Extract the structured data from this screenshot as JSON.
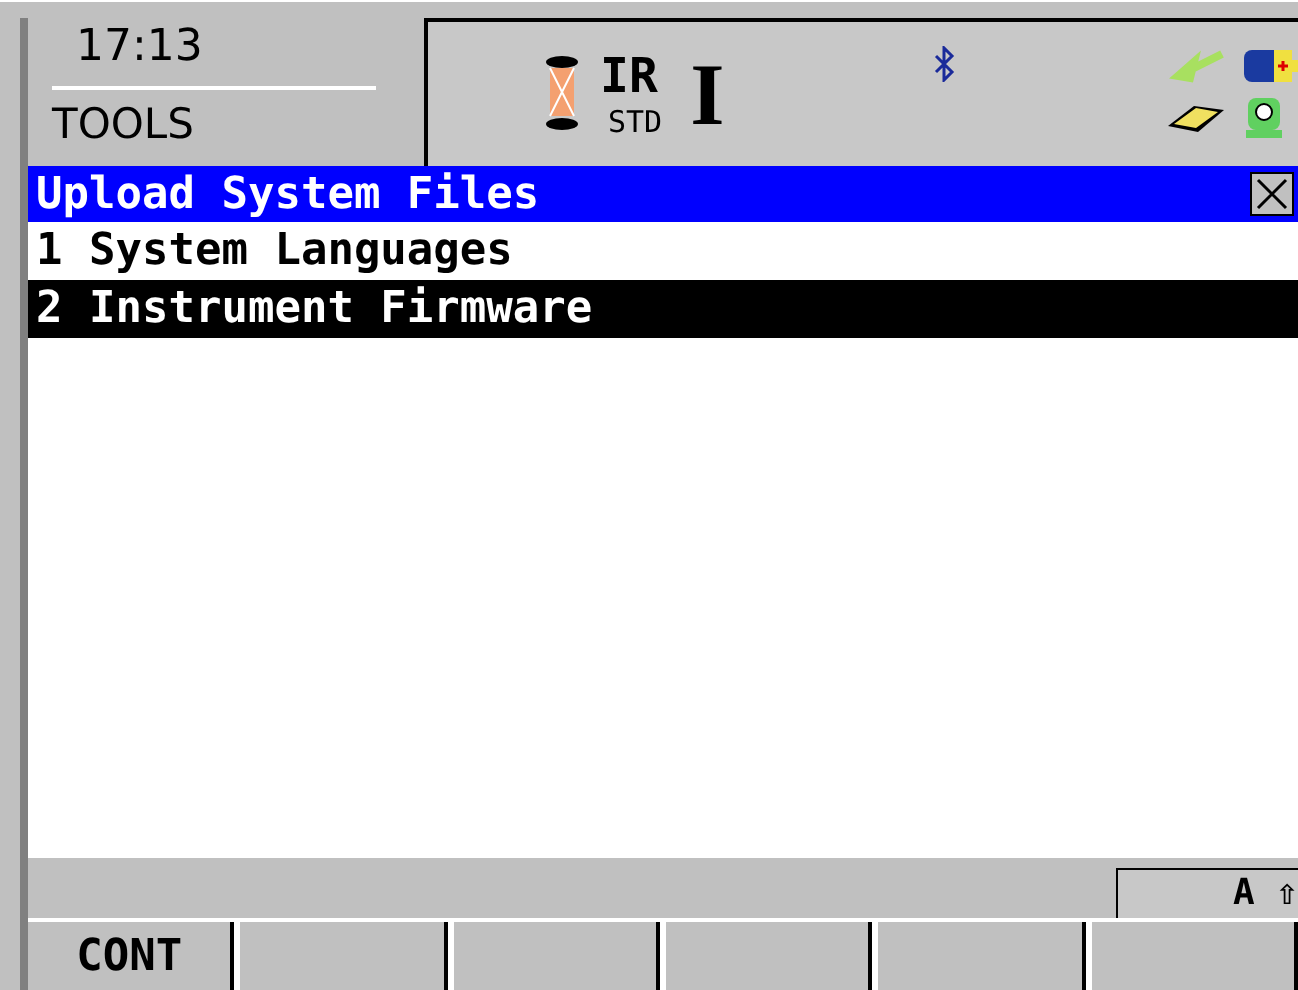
{
  "header": {
    "time": "17:13",
    "screen": "TOOLS",
    "mode": "IR",
    "mode_sub": "STD",
    "cursor": "I"
  },
  "title": "Upload System Files",
  "menu": [
    {
      "label": "1 System Languages",
      "selected": false
    },
    {
      "label": "2 Instrument Firmware",
      "selected": true
    }
  ],
  "input_mode": "A ⇧",
  "softkeys": [
    {
      "kind": "labeled",
      "label": "CONT"
    },
    {
      "kind": "blank"
    },
    {
      "kind": "blank"
    },
    {
      "kind": "blank"
    },
    {
      "kind": "blank"
    },
    {
      "kind": "blank"
    }
  ]
}
